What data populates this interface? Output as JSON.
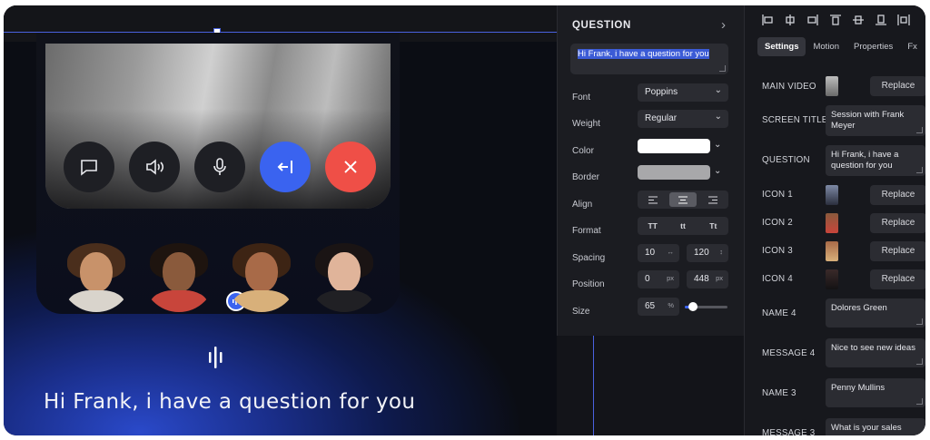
{
  "preview": {
    "caption": "Hi Frank, i have a question for you",
    "controls": [
      "chat-icon",
      "speaker-icon",
      "microphone-icon",
      "exit-arrow-icon",
      "close-icon"
    ],
    "participants": [
      {
        "name": "participant-1",
        "skin": "#c8926a",
        "hair": "#4a2e1c",
        "shirt": "#d9d4cc"
      },
      {
        "name": "participant-2",
        "skin": "#8a5a3c",
        "hair": "#1e140f",
        "shirt": "#c8453b"
      },
      {
        "name": "participant-3",
        "skin": "#a86a48",
        "hair": "#3d2414",
        "shirt": "#d8b07a"
      },
      {
        "name": "participant-4",
        "skin": "#e0b49a",
        "hair": "#1a1414",
        "shirt": "#202024"
      }
    ]
  },
  "question_panel": {
    "title": "QUESTION",
    "text": "Hi Frank, i have a question for you",
    "font_label": "Font",
    "font_value": "Poppins",
    "weight_label": "Weight",
    "weight_value": "Regular",
    "color_label": "Color",
    "color_value": "#ffffff",
    "border_label": "Border",
    "border_value": "#a8a8aa",
    "align_label": "Align",
    "align_options": [
      "align-left-icon",
      "align-center-icon",
      "align-right-icon"
    ],
    "align_selected": "center",
    "format_label": "Format",
    "format_options": [
      "TT",
      "tt",
      "Tt"
    ],
    "spacing_label": "Spacing",
    "spacing_letter": "10",
    "spacing_letter_unit": "↔",
    "spacing_line": "120",
    "spacing_line_unit": "↕",
    "position_label": "Position",
    "position_x": "0",
    "position_x_unit": "px",
    "position_y": "448",
    "position_y_unit": "px",
    "size_label": "Size",
    "size_value": "65",
    "size_unit": "%",
    "size_slider_fraction": 0.2
  },
  "settings_panel": {
    "toolbar_icons": [
      "align-left-edge-icon",
      "align-horizontal-center-icon",
      "align-right-edge-icon",
      "align-top-edge-icon",
      "align-vertical-center-icon",
      "align-bottom-edge-icon",
      "distribute-icon"
    ],
    "tabs": [
      "Settings",
      "Motion",
      "Properties",
      "Fx"
    ],
    "active_tab": "Settings",
    "replace_label": "Replace",
    "rows": {
      "main_video": "MAIN VIDEO",
      "screen_title": "SCREEN TITLE",
      "screen_title_value": "Session with Frank Meyer",
      "question": "QUESTION",
      "question_value": "Hi Frank, i have a question for you",
      "icon1": "ICON 1",
      "icon2": "ICON 2",
      "icon3": "ICON 3",
      "icon4": "ICON 4",
      "name4": "NAME 4",
      "name4_value": "Dolores Green",
      "message4": "MESSAGE 4",
      "message4_value": "Nice to see new ideas",
      "name3": "NAME 3",
      "name3_value": "Penny Mullins",
      "message3": "MESSAGE 3",
      "message3_value": "What is your sales"
    }
  }
}
